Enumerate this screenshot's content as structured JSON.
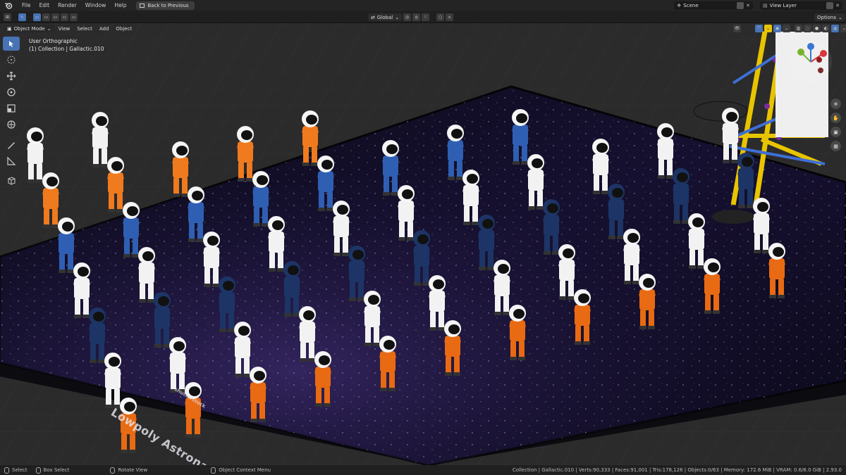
{
  "topbar": {
    "menus": [
      "File",
      "Edit",
      "Render",
      "Window",
      "Help"
    ],
    "back_label": "Back to Previous",
    "scene_label": "Scene",
    "view_layer_label": "View Layer"
  },
  "header2": {
    "orientation": "Global",
    "options_label": "Options"
  },
  "header3": {
    "mode": "Object Mode",
    "menus": [
      "View",
      "Select",
      "Add",
      "Object"
    ]
  },
  "viewport": {
    "view_name": "User Orthographic",
    "collection_info": "(1) Collection | Gallactic.010",
    "floor_title": "Lowpoly Astronauts",
    "floor_logo_text": "shutterstock",
    "accent_color": "#4772b3"
  },
  "toolbar": {
    "tools": [
      "select-box-icon",
      "cursor-icon",
      "move-icon",
      "rotate-icon",
      "scale-icon",
      "transform-icon",
      "annotate-icon",
      "measure-icon",
      "add-cube-icon"
    ]
  },
  "statusbar": {
    "select_label": "Select",
    "box_select_label": "Box Select",
    "rotate_label": "Rotate View",
    "context_menu_label": "Object Context Menu",
    "stats": "Collection | Gallactic.010 | Verts:90,333 | Faces:91,001 | Tris:178,126 | Objects:0/63 | Memory: 172.6 MiB | VRAM: 0.6/6.0 GiB | 2.93.0"
  }
}
